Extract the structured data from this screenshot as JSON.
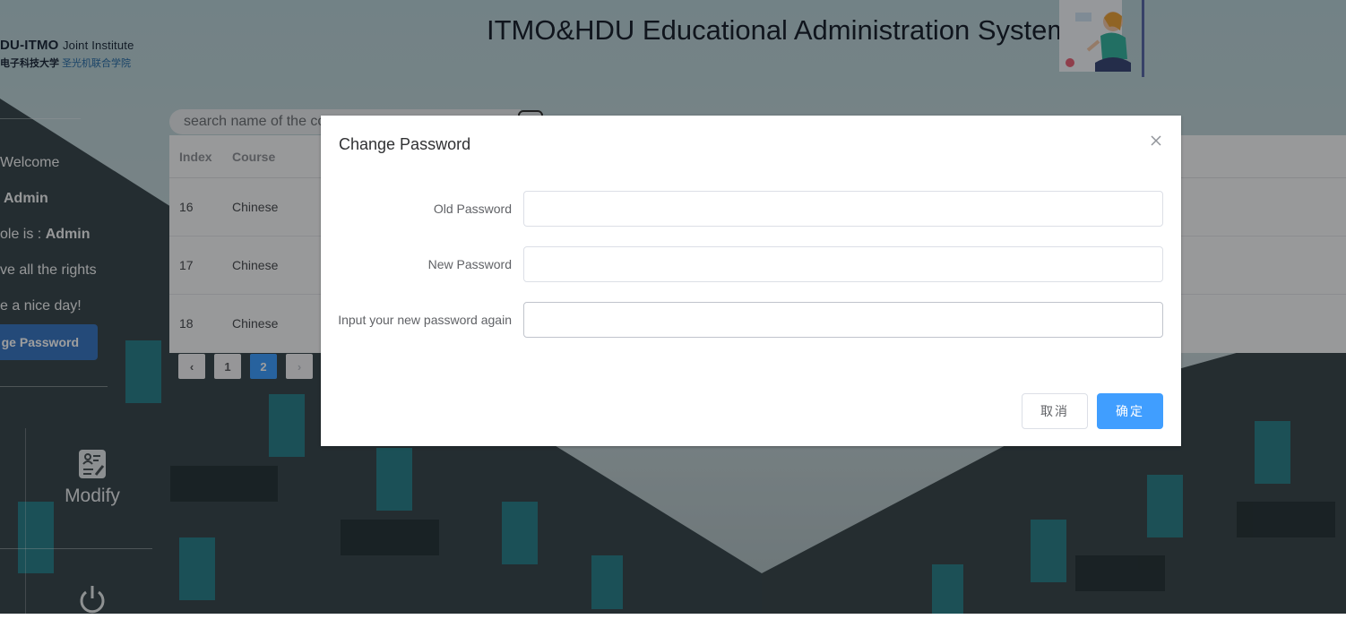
{
  "header": {
    "logo_line1_main": "DU-ITMO",
    "logo_line1_sub": "Joint Institute",
    "logo_line2_cn1": "电子科技大学",
    "logo_line2_cn2": "圣光机联合学院",
    "title": "ITMO&HDU Educational Administration System"
  },
  "sidebar": {
    "welcome": "Welcome",
    "user": "Admin",
    "role_prefix": "ole is : ",
    "role": "Admin",
    "rights": "ve all the rights",
    "greeting": "e a nice day!",
    "change_password_label": "ge Password",
    "nav": {
      "modify_label": "Modify",
      "modify_icon": "edit-document-icon",
      "logout_icon": "power-icon"
    }
  },
  "search": {
    "placeholder": "search name of the co"
  },
  "table": {
    "columns": [
      "Index",
      "Course"
    ],
    "rows": [
      {
        "index": "16",
        "course": "Chinese"
      },
      {
        "index": "17",
        "course": "Chinese"
      },
      {
        "index": "18",
        "course": "Chinese"
      }
    ]
  },
  "pagination": {
    "prev": "‹",
    "pages": [
      "1",
      "2"
    ],
    "current": "2",
    "next": "›"
  },
  "modal": {
    "title": "Change Password",
    "close": "×",
    "fields": [
      {
        "label": "Old Password",
        "value": ""
      },
      {
        "label": "New Password",
        "value": ""
      },
      {
        "label": "Input your new password again",
        "value": ""
      }
    ],
    "cancel_label": "取消",
    "confirm_label": "确定"
  },
  "colors": {
    "primary": "#409eff",
    "sidebar_button": "#3a78c3",
    "overlay": "rgba(0,0,0,0.38)"
  }
}
